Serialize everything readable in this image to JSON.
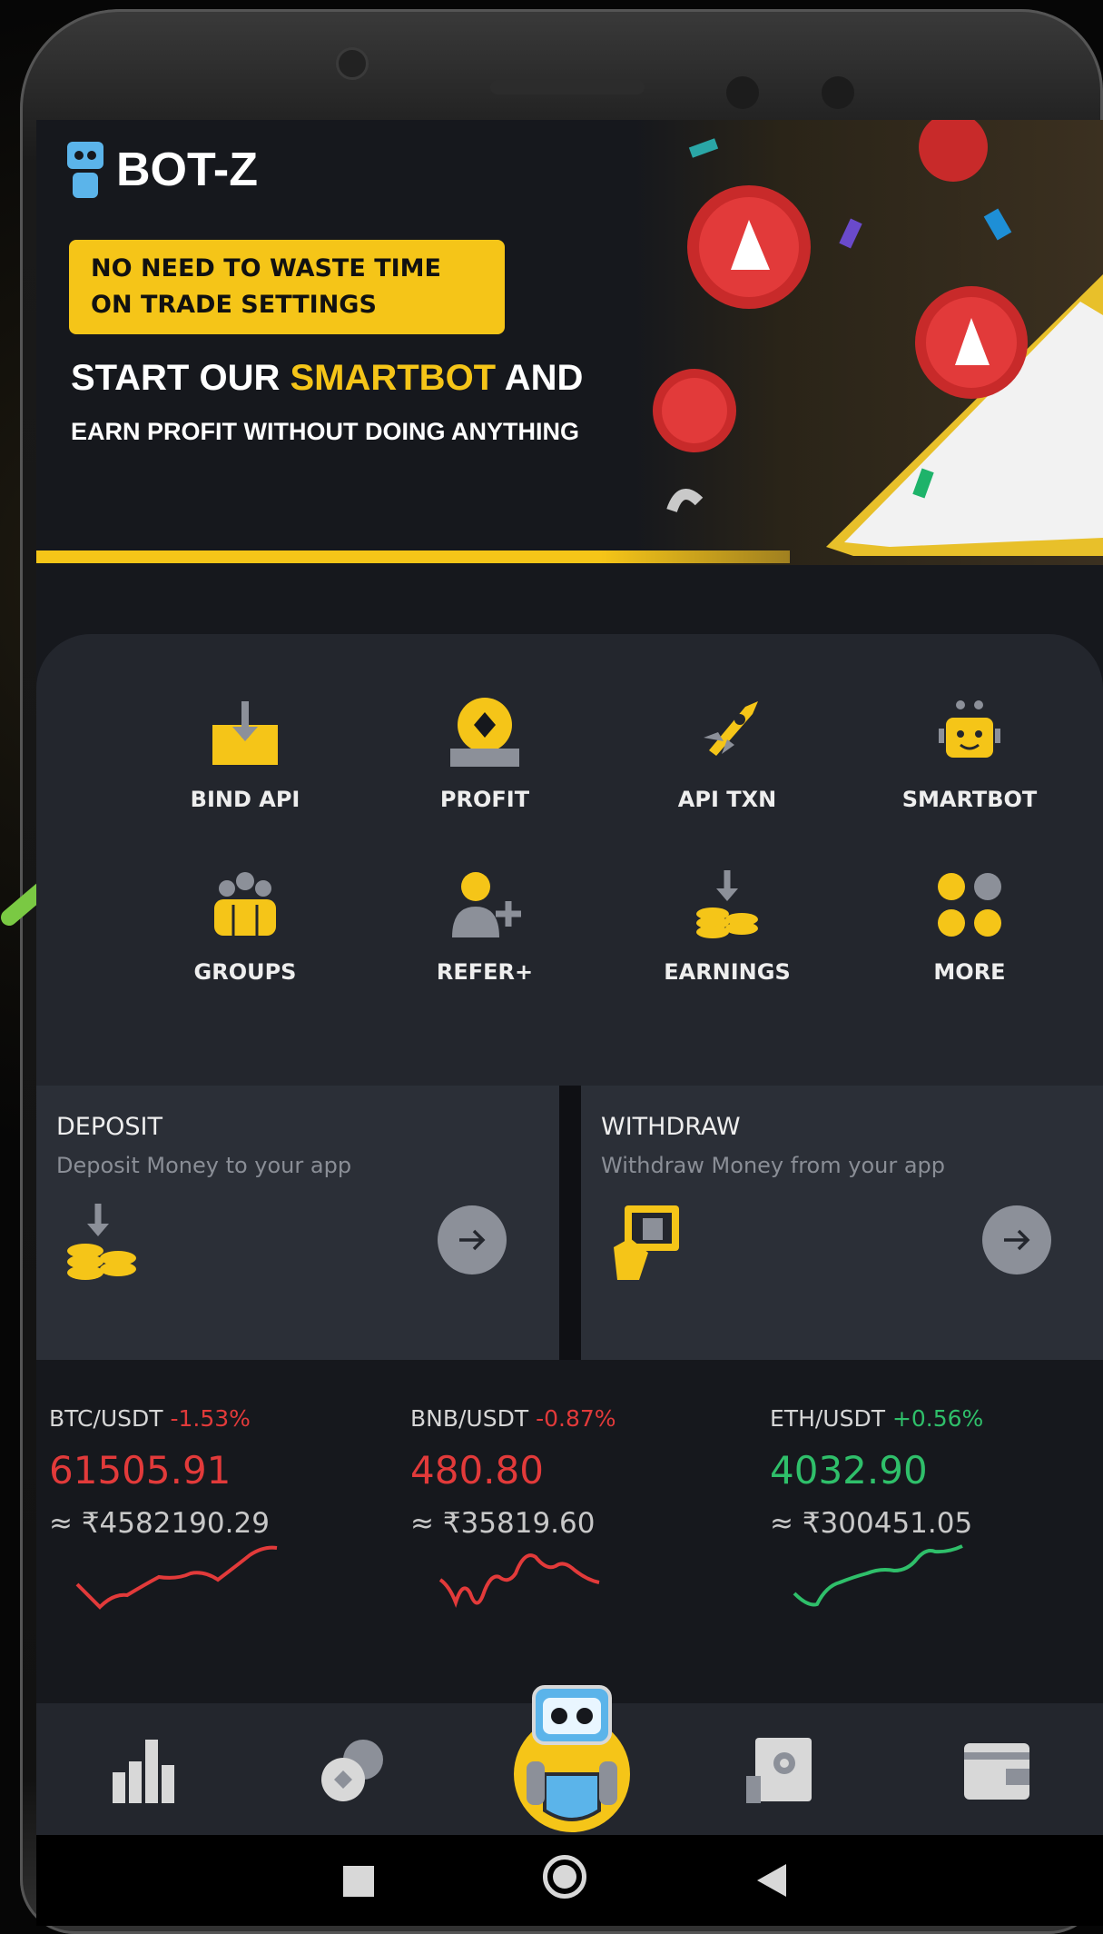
{
  "brand": {
    "logo_text": "BOT-Z"
  },
  "banner": {
    "tag_line1": "NO NEED TO WASTE TIME",
    "tag_line2": "ON TRADE SETTINGS",
    "headline_pre": "START OUR ",
    "headline_highlight": "SMARTBOT",
    "headline_post": " AND",
    "subline": "EARN PROFIT WITHOUT  DOING ANYTHING"
  },
  "menu": [
    {
      "label": "BIND API",
      "icon": "bind-api-icon"
    },
    {
      "label": "PROFIT",
      "icon": "profit-icon"
    },
    {
      "label": "API TXN",
      "icon": "rocket-icon"
    },
    {
      "label": "SMARTBOT",
      "icon": "robot-icon"
    },
    {
      "label": "GROUPS",
      "icon": "groups-icon"
    },
    {
      "label": "REFER+",
      "icon": "add-user-icon"
    },
    {
      "label": "EARNINGS",
      "icon": "coins-icon"
    },
    {
      "label": "MORE",
      "icon": "more-grid-icon"
    }
  ],
  "cards": {
    "deposit": {
      "title": "DEPOSIT",
      "subtitle": "Deposit Money to your app"
    },
    "withdraw": {
      "title": "WITHDRAW",
      "subtitle": "Withdraw Money from your app"
    }
  },
  "tickers": [
    {
      "pair": "BTC/USDT",
      "change": "-1.53%",
      "price": "61505.91",
      "inr": "≈ ₹4582190.29",
      "trend": "down"
    },
    {
      "pair": "BNB/USDT",
      "change": "-0.87%",
      "price": "480.80",
      "inr": "≈ ₹35819.60",
      "trend": "down"
    },
    {
      "pair": "ETH/USDT",
      "change": "+0.56%",
      "price": "4032.90",
      "inr": "≈ ₹300451.05",
      "trend": "up"
    }
  ],
  "bottom_nav": [
    "chart-icon",
    "coins-tab-icon",
    "bot-home-icon",
    "safe-icon",
    "wallet-icon"
  ],
  "colors": {
    "accent": "#f5c518",
    "down": "#e23a3a",
    "up": "#2fbf6a",
    "bg": "#16181d",
    "panel": "#23262d"
  }
}
